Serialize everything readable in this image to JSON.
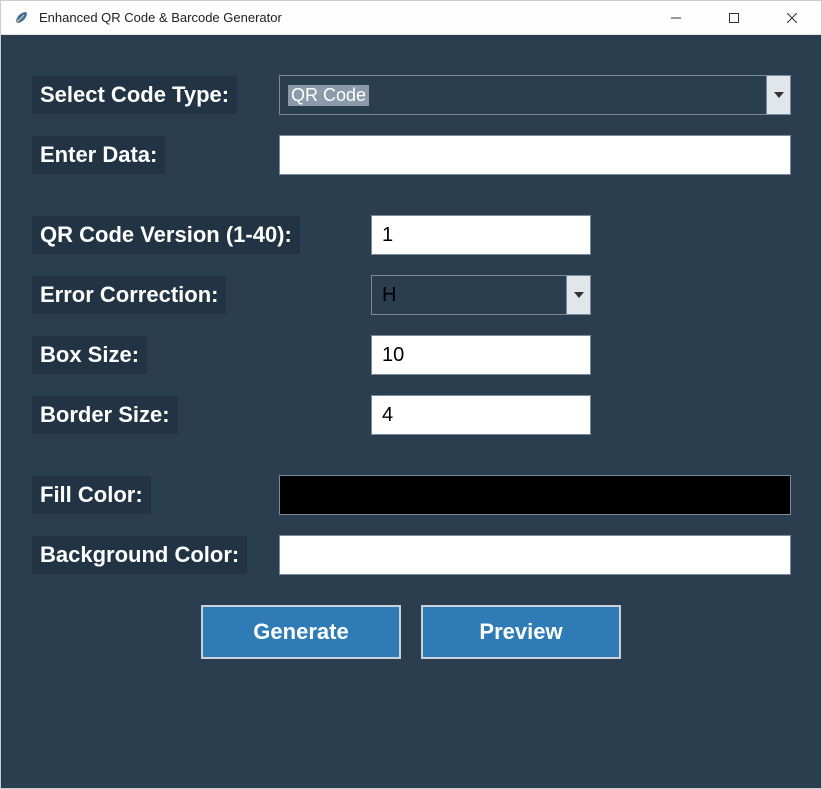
{
  "window": {
    "title": "Enhanced QR Code & Barcode Generator"
  },
  "labels": {
    "select_code_type": "Select Code Type:",
    "enter_data": "Enter Data:",
    "qr_version": "QR Code Version (1-40):",
    "error_correction": "Error Correction:",
    "box_size": "Box Size:",
    "border_size": "Border Size:",
    "fill_color": "Fill Color:",
    "background_color": "Background Color:"
  },
  "inputs": {
    "code_type": "QR Code",
    "data": "",
    "qr_version": "1",
    "error_correction": "H",
    "box_size": "10",
    "border_size": "4"
  },
  "colors": {
    "fill": "#000000",
    "background": "#ffffff"
  },
  "buttons": {
    "generate": "Generate",
    "preview": "Preview"
  }
}
